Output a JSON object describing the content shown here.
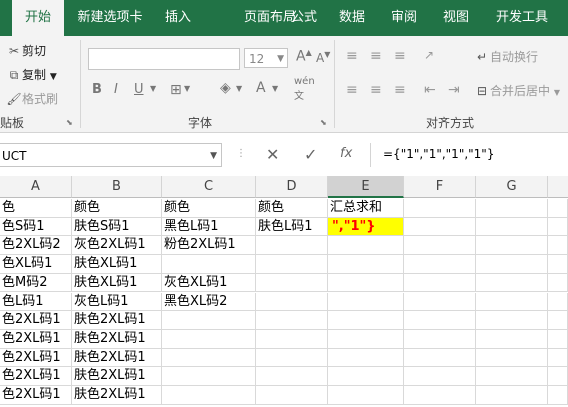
{
  "tabs": [
    "开始",
    "新建选项卡",
    "插入",
    "页面布局",
    "公式",
    "数据",
    "审阅",
    "视图",
    "开发工具"
  ],
  "clipboard": {
    "cut": "剪切",
    "copy": "复制",
    "format_painter": "格式刷",
    "label": "贴板"
  },
  "font": {
    "name": "",
    "size": "12",
    "label": "字体",
    "bold": "B",
    "italic": "I",
    "underline": "U",
    "wen": "wén"
  },
  "alignment": {
    "wrap": "自动换行",
    "merge": "合并后居中",
    "label": "对齐方式"
  },
  "namebox": "UCT",
  "formula": "={\"1\",\"1\",\"1\",\"1\"}",
  "columns": [
    "A",
    "B",
    "C",
    "D",
    "E",
    "F",
    "G"
  ],
  "rows": [
    [
      "色",
      "颜色",
      "颜色",
      "颜色",
      "汇总求和"
    ],
    [
      "色S码1",
      "肤色S码1",
      "黑色L码1",
      "肤色L码1",
      "\",\"1\"}"
    ],
    [
      "色2XL码2",
      "灰色2XL码1",
      "粉色2XL码1",
      "",
      ""
    ],
    [
      "色XL码1",
      "肤色XL码1",
      "",
      "",
      ""
    ],
    [
      "色M码2",
      "肤色XL码1",
      "灰色XL码1",
      "",
      ""
    ],
    [
      "色L码1",
      "灰色L码1",
      "黑色XL码2",
      "",
      ""
    ],
    [
      "色2XL码1",
      "肤色2XL码1",
      "",
      "",
      ""
    ],
    [
      "色2XL码1",
      "肤色2XL码1",
      "",
      "",
      ""
    ],
    [
      "色2XL码1",
      "肤色2XL码1",
      "",
      "",
      ""
    ],
    [
      "色2XL码1",
      "肤色2XL码1",
      "",
      "",
      ""
    ],
    [
      "色2XL码1",
      "肤色2XL码1",
      "",
      "",
      ""
    ]
  ],
  "colors": {
    "brand": "#217346",
    "highlight": "#ffff00",
    "formula_text": "#ff0000"
  }
}
